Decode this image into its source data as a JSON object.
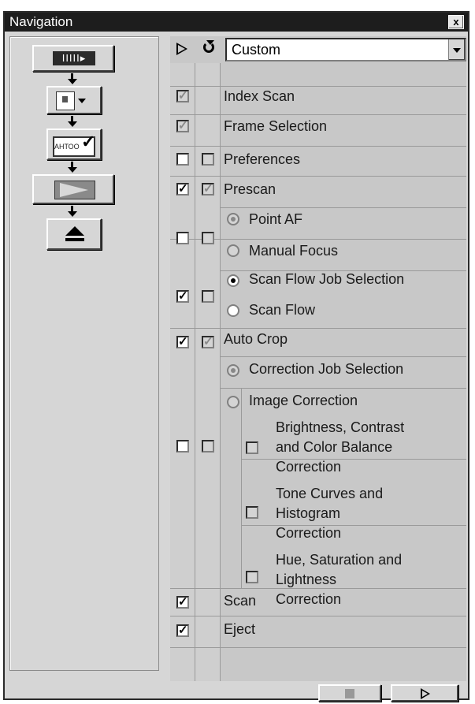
{
  "window": {
    "title": "Navigation",
    "close_label": "x"
  },
  "header": {
    "preset_value": "Custom"
  },
  "icons": {
    "col1_header": "play-triangle-icon",
    "col2_header": "loop-arrow-icon"
  },
  "rows": {
    "index_scan": "Index Scan",
    "frame_selection": "Frame Selection",
    "preferences": "Preferences",
    "prescan": "Prescan",
    "point_af": "Point AF",
    "manual_focus": "Manual Focus",
    "scan_flow_job_selection": "Scan Flow Job Selection",
    "scan_flow": "Scan Flow",
    "auto_crop": "Auto Crop",
    "correction_job_selection": "Correction Job Selection",
    "image_correction": "Image Correction",
    "brightness_l1": "Brightness, Contrast",
    "brightness_l2": "and Color Balance",
    "brightness_l3": "Correction",
    "tone_l1": "Tone Curves and",
    "tone_l2": "Histogram",
    "tone_l3": "Correction",
    "hue_l1": "Hue, Saturation and",
    "hue_l2": "Lightness",
    "hue_l3": "Correction",
    "scan": "Scan",
    "eject": "Eject"
  },
  "left_nav": {
    "index_button_label": "IIIII▸",
    "job_button_label": "АНТОО"
  },
  "colors": {
    "title_bg": "#1d1d1d",
    "panel_bg": "#d6d6d6",
    "column_bg": "#cfcfcf"
  }
}
